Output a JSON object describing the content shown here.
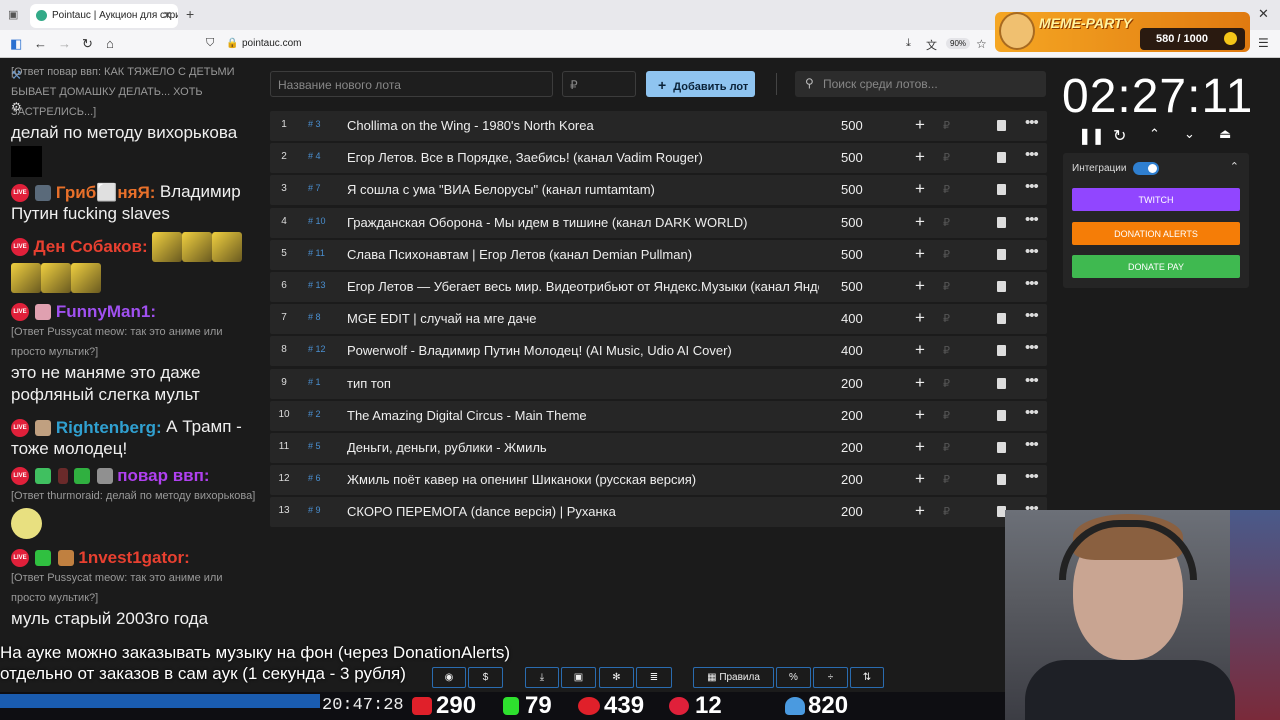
{
  "browser": {
    "tab_title": "Pointauc | Аукцион для стримеров",
    "url": "pointauc.com",
    "zoom": "90%"
  },
  "meme_party": {
    "title": "MEME-PARTY",
    "counter": "580 / 1000"
  },
  "chat": {
    "messages": [
      {
        "reply": "[Ответ повар ввп: КАК ТЯЖЕЛО С ДЕТЬМИ БЫВАЕТ ДОМАШКУ ДЕЛАТЬ... ХОТЬ ЗАСТРЕЛИСЬ...]",
        "text": "делай по методу вихорькова"
      },
      {
        "nick": "Гриб⬜няЯ:",
        "nick_color": "#e8702a",
        "text": "Владимир Путин fucking slaves"
      },
      {
        "nick": "Ден Собаков:",
        "nick_color": "#e84030"
      },
      {
        "nick": "FunnyMan1:",
        "nick_color": "#a050f0",
        "reply": "[Ответ Pussycat meow: так это аниме или просто мультик?]",
        "text": "это не маняме это даже рофляный слегка мульт"
      },
      {
        "nick": "Rightenberg:",
        "nick_color": "#30a0d0",
        "text": "А Трамп - тоже молодец!"
      },
      {
        "nick": "повар ввп:",
        "nick_color": "#b040f0",
        "reply": "[Ответ thurmoraid: делай по методу вихорькова]"
      },
      {
        "nick": "1nvest1gator:",
        "nick_color": "#e84030",
        "reply": "[Ответ Pussycat meow: так это аниме или просто мультик?]",
        "text": "муль старый 2003го года"
      }
    ]
  },
  "toolbar": {
    "new_lot_placeholder": "Название нового лота",
    "amount_placeholder": "₽",
    "add_label": "Добавить лот",
    "search_placeholder": "Поиск среди лотов..."
  },
  "lots": [
    {
      "n": "1",
      "id": "# 3",
      "title": "Chollima on the Wing - 1980's North Korea",
      "amount": "500"
    },
    {
      "n": "2",
      "id": "# 4",
      "title": "Егор Летов. Все в Порядке, Заебись! (канал Vadim Rouger)",
      "amount": "500"
    },
    {
      "n": "3",
      "id": "# 7",
      "title": "Я сошла с ума \"ВИА Белорусы\" (канал rumtamtam)",
      "amount": "500"
    },
    {
      "n": "4",
      "id": "# 10",
      "title": "Гражданская Оборона - Мы идем в тишине (канал DARK WORLD)",
      "amount": "500"
    },
    {
      "n": "5",
      "id": "# 11",
      "title": "Слава Психонавтам | Егор Летов (канал Demian Pullman)",
      "amount": "500"
    },
    {
      "n": "6",
      "id": "# 13",
      "title": "Егор Летов — Убегает весь мир. Видеотрибьют от Яндекс.Музыки (канал Яндекс",
      "amount": "500"
    },
    {
      "n": "7",
      "id": "# 8",
      "title": "MGE EDIT | случай на мге даче",
      "amount": "400"
    },
    {
      "n": "8",
      "id": "# 12",
      "title": "Powerwolf - Владимир Путин Молодец! (AI Music, Udio AI Cover)",
      "amount": "400"
    },
    {
      "n": "9",
      "id": "# 1",
      "title": "тип топ",
      "amount": "200"
    },
    {
      "n": "10",
      "id": "# 2",
      "title": "The Amazing Digital Circus - Main Theme",
      "amount": "200"
    },
    {
      "n": "11",
      "id": "# 5",
      "title": "Деньги, деньги, рублики - Жмиль",
      "amount": "200"
    },
    {
      "n": "12",
      "id": "# 6",
      "title": "Жмиль поёт кавер на опенинг Шиканоки (русская версия)",
      "amount": "200"
    },
    {
      "n": "13",
      "id": "# 9",
      "title": "СКОРО ПЕРЕМОГА (dance версія) | Руханка",
      "amount": "200"
    }
  ],
  "lot_currency": "₽",
  "timer": "02:27:11",
  "integrations": {
    "label": "Интеграции",
    "buttons": [
      {
        "label": "TWITCH",
        "color": "#9146ff"
      },
      {
        "label": "DONATION ALERTS",
        "color": "#f57d07"
      },
      {
        "label": "DONATE PAY",
        "color": "#3fb950"
      }
    ]
  },
  "caption": {
    "line1": "На ауке можно заказывать музыку на фон (через DonationAlerts)",
    "line2": "отдельно от заказов в сам аук (1 секунда - 3 рубля)"
  },
  "bottom_bar": {
    "rules_label": "Правила",
    "percent_label": "%"
  },
  "stream_stats": {
    "clock": "20:47:28",
    "youtube": "290",
    "kick": "79",
    "vk": "439",
    "rutube": "12",
    "viewers": "820"
  }
}
